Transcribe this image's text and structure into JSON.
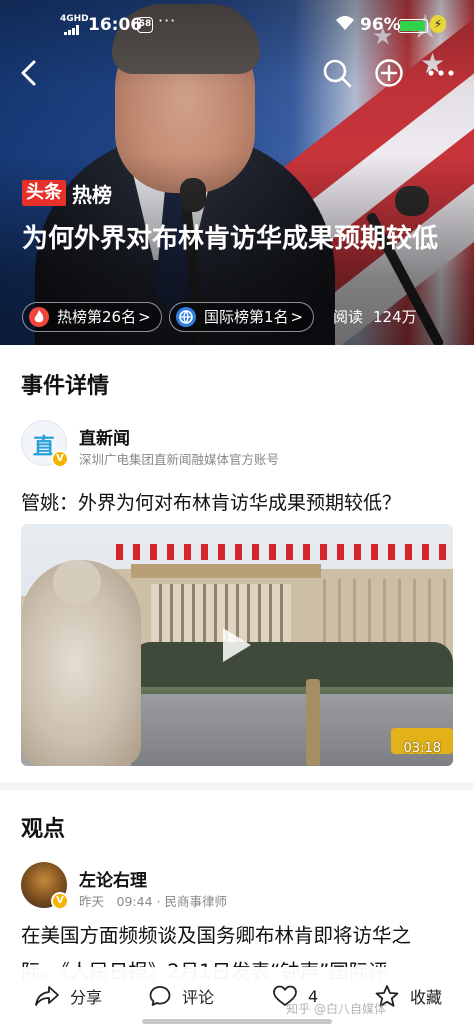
{
  "status_bar": {
    "network": "4GHD",
    "time": "16:06",
    "badge": "58",
    "more": "···",
    "battery_pct": "96%",
    "battery_level": 0.96,
    "battery_color": "#33d24d"
  },
  "nav": {
    "back_icon": "chevron-left-icon",
    "search_icon": "search-icon",
    "add_icon": "plus-circle-icon",
    "more_icon": "more-dots-icon"
  },
  "hero": {
    "brand_box": "头条",
    "brand_text": "热榜",
    "title": "为何外界对布林肯访华成果预期较低",
    "chip_hot": "热榜第26名",
    "chip_intl": "国际榜第1名",
    "chip_arrow": ">",
    "reads_label": "阅读",
    "reads_value": "124万",
    "accent": "#e8302a"
  },
  "detail": {
    "section_title": "事件详情",
    "source_logo": "直",
    "source_name": "直新闻",
    "source_desc": "深圳广电集团直新闻融媒体官方账号",
    "question": "管姚：外界为何对布林肯访华成果预期较低？",
    "video_duration": "03:18"
  },
  "opinion": {
    "section_title": "观点",
    "author_name": "左论右理",
    "author_meta": "昨天　09:44 · 民商事律师",
    "body_line1": "在美国方面频频谈及国务卿布林肯即将访华之",
    "body_line2": "际，《人民日报》2月1日发表“钟声”国际评"
  },
  "bottom_bar": {
    "share": "分享",
    "comment": "评论",
    "likes": "4",
    "favorite": "收藏",
    "watermark": "知乎 @白八自媒体"
  }
}
